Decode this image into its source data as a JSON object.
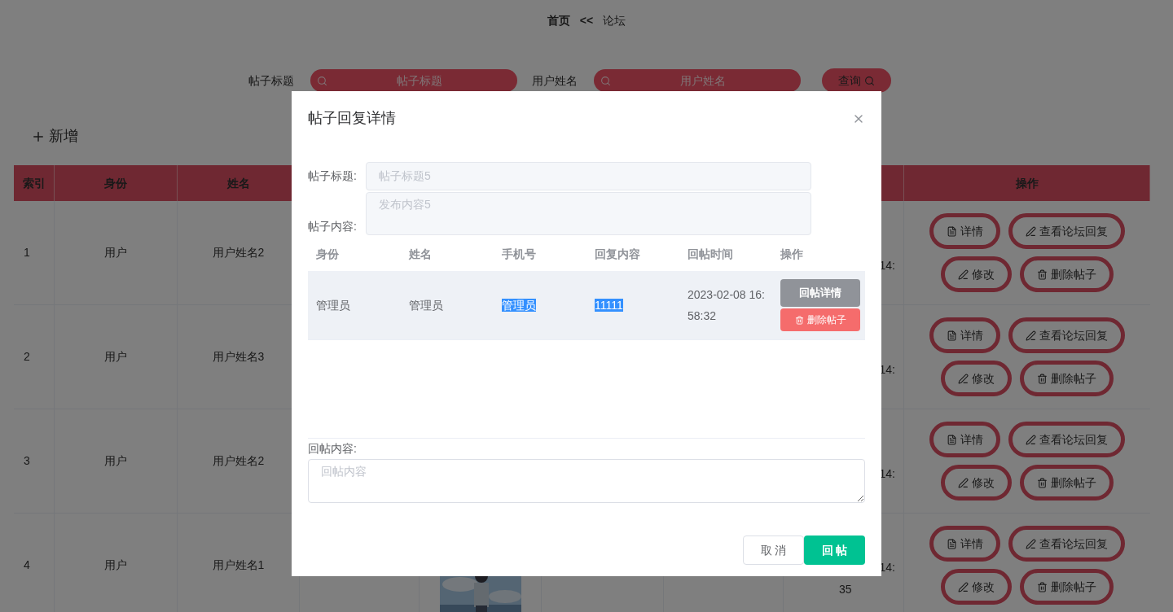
{
  "breadcrumb": [
    {
      "label": "首页",
      "bold": true
    },
    {
      "label": "<<",
      "bold": true
    },
    {
      "label": "论坛",
      "bold": false
    }
  ],
  "search": {
    "fields": [
      {
        "label": "帖子标题",
        "placeholder": "帖子标题"
      },
      {
        "label": "用户姓名",
        "placeholder": "用户姓名"
      }
    ],
    "button": "查询"
  },
  "add_button": "新增",
  "table": {
    "columns": [
      {
        "label": "索引"
      },
      {
        "label": "身份"
      },
      {
        "label": "姓名"
      },
      {
        "label": "操作"
      }
    ],
    "rows": [
      {
        "index": "1",
        "role": "用户",
        "name": "用户姓名2",
        "time": [
          "14:"
        ],
        "actions": [
          "详情",
          "查看论坛回复",
          "修改",
          "删除帖子"
        ]
      },
      {
        "index": "2",
        "role": "用户",
        "name": "用户姓名3",
        "time": [
          "14:"
        ],
        "actions": [
          "详情",
          "查看论坛回复",
          "修改",
          "删除帖子"
        ]
      },
      {
        "index": "3",
        "role": "用户",
        "name": "用户姓名2",
        "time": [
          "14:"
        ],
        "actions": [
          "详情",
          "查看论坛回复",
          "修改",
          "删除帖子"
        ]
      },
      {
        "index": "4",
        "role": "用户",
        "name": "用户姓名1",
        "picture": {
          "kind": "picture"
        },
        "time": [
          "14:",
          "35"
        ],
        "actions": [
          "详情",
          "查看论坛回复",
          "修改",
          "删除帖子"
        ]
      }
    ]
  },
  "dialog": {
    "title": "帖子回复详情",
    "fields": [
      {
        "label": "帖子标题:",
        "value": "帖子标题5",
        "kind": "input"
      },
      {
        "label": "帖子内容:",
        "value": "发布内容5",
        "kind": "textarea"
      }
    ],
    "table": {
      "columns": [
        "身份",
        "姓名",
        "手机号",
        "回复内容",
        "回帖时间",
        "操作"
      ],
      "rows": [
        {
          "hovered": true,
          "cells": [
            {
              "text": "管理员",
              "highlighted": false
            },
            {
              "text": "管理员",
              "highlighted": false
            },
            {
              "text": "管理员",
              "highlighted": true
            },
            {
              "text": "11111",
              "highlighted": true
            },
            {
              "text": "2023-02-08 16:58:32",
              "highlighted": false
            }
          ],
          "actions": [
            {
              "label": "回帖详情",
              "kind": "info"
            },
            {
              "label": "删除帖子",
              "kind": "danger"
            }
          ]
        }
      ]
    },
    "reply": {
      "label": "回帖内容:",
      "placeholder": "回帖内容"
    },
    "buttons": [
      {
        "label": "取 消",
        "kind": "default"
      },
      {
        "label": "回 帖",
        "kind": "primary"
      }
    ]
  }
}
